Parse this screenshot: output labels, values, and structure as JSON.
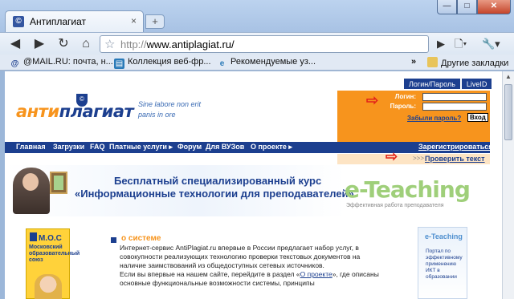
{
  "browser": {
    "tab_title": "Антиплагиат",
    "tab_close": "×",
    "new_tab": "+",
    "address_proto": "http://",
    "address_host": "www.antiplagiat.ru/",
    "window_buttons": {
      "minimize": "—",
      "maximize": "□",
      "close": "✕"
    }
  },
  "bookmarks": [
    {
      "label": "@MAIL.RU: почта, н...",
      "icon": "mail-icon",
      "color": "#1c3f8f"
    },
    {
      "label": "Коллекция веб-фр...",
      "icon": "collection-icon",
      "color": "#2a7ab8"
    },
    {
      "label": "Рекомендуемые уз...",
      "icon": "ie-icon",
      "color": "#2a7ab8"
    }
  ],
  "bookmarks_overflow": "»",
  "other_bookmarks": "Другие закладки",
  "page": {
    "login_tabs": [
      "Логин/Пароль",
      "LiveID"
    ],
    "login_label": "Логин:",
    "password_label": "Пароль:",
    "forgot_password": "Забыли пароль?",
    "enter": "Вход",
    "logo_part1": "анти",
    "logo_part2": "плагиат",
    "seal": "©",
    "motto_line1": "Sine labore non erit",
    "motto_line2": "panis in ore",
    "nav": [
      "Главная",
      "Загрузки",
      "FAQ",
      "Платные услуги ▸",
      "Форум",
      "Для ВУЗов",
      "О проекте ▸"
    ],
    "register": "Зарегистрироваться",
    "check_arrows": ">>>",
    "check_text": "Проверить текст",
    "banner_line1": "Бесплатный специализированный курс",
    "banner_line2": "«Информационные технологии для преподавателей»",
    "banner_logo": "e-Teaching",
    "banner_logo_sub": "Эффективная работа преподавателя",
    "mos_title": "М.О.С",
    "mos_text": "Московский образовательный союз",
    "about_title": "о системе",
    "about_p1": "Интернет-сервис AntiPlagiat.ru впервые в России предлагает набор услуг, в совокупности реализующих технологию проверки текстовых документов на наличие заимствований из общедоступных сетевых источников.",
    "about_p2_before": "Если вы впервые на нашем сайте, перейдите в раздел «",
    "about_p2_link": "О проекте",
    "about_p2_after": "», где описаны основные функциональные возможности системы, принципы",
    "side_logo": "e-Teaching",
    "side_text": "Портал по эффективному применению ИКТ в образовании"
  },
  "colors": {
    "brand_blue": "#1c3f8f",
    "brand_orange": "#f7941d",
    "arrow_red": "#e2231a"
  }
}
